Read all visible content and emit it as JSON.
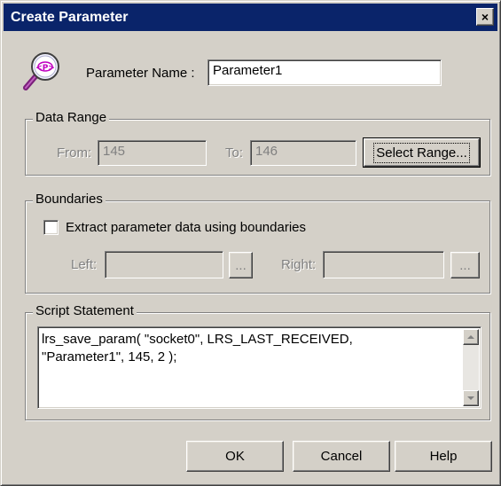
{
  "window": {
    "title": "Create Parameter",
    "close_glyph": "×"
  },
  "param": {
    "icon": "magnifier-param-icon",
    "label": "Parameter Name :",
    "value": "Parameter1"
  },
  "data_range": {
    "title": "Data Range",
    "from_label": "From:",
    "from_value": "145",
    "to_label": "To:",
    "to_value": "146",
    "select_button": "Select Range..."
  },
  "boundaries": {
    "title": "Boundaries",
    "checkbox_label": "Extract parameter data using boundaries",
    "checked": false,
    "left_label": "Left:",
    "left_value": "",
    "right_label": "Right:",
    "right_value": "",
    "browse_label": "..."
  },
  "script": {
    "title": "Script Statement",
    "text": "lrs_save_param( \"socket0\", LRS_LAST_RECEIVED,\n\"Parameter1\", 145, 2 );"
  },
  "buttons": {
    "ok": "OK",
    "cancel": "Cancel",
    "help": "Help"
  },
  "colors": {
    "titlebar": "#0a246a",
    "face": "#d4d0c8"
  }
}
